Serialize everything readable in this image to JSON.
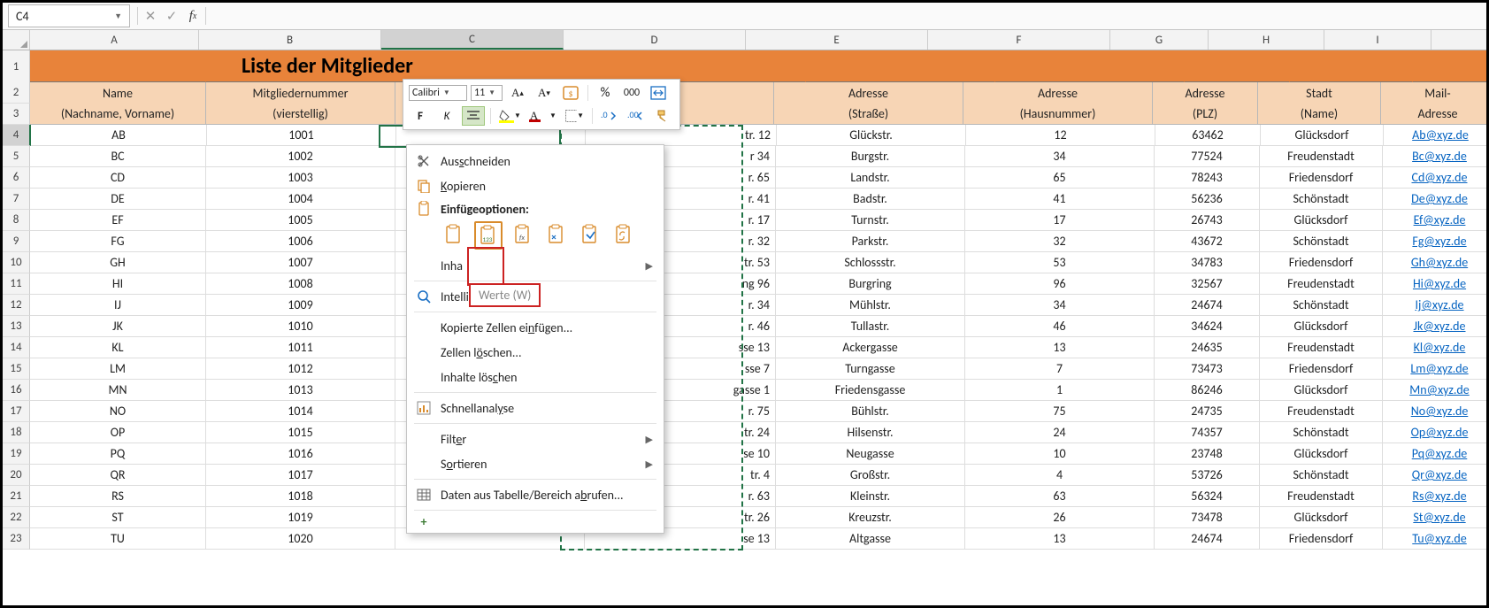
{
  "nameBox": "C4",
  "title": "Liste der Mitglieder",
  "columns": [
    "A",
    "B",
    "C",
    "D",
    "E",
    "F",
    "G",
    "H",
    "I"
  ],
  "headers": {
    "A1": "Name",
    "A2": "(Nachname, Vorname)",
    "B1": "Mitgliedernummer",
    "B2": "(vierstellig)",
    "E1": "Adresse",
    "E2": "(Straße)",
    "F1": "Adresse",
    "F2": "(Hausnummer)",
    "G1": "Adresse",
    "G2": "(PLZ)",
    "H1": "Stadt",
    "H2": "(Name)",
    "I1": "Mail-",
    "I2": "Adresse"
  },
  "rows": [
    {
      "n": "AB",
      "id": "1001",
      "d": "tr. 12",
      "str": "Glückstr.",
      "hn": "12",
      "plz": "63462",
      "city": "Glücksdorf",
      "mail": "Ab@xyz.de"
    },
    {
      "n": "BC",
      "id": "1002",
      "d": "r 34",
      "str": "Burgstr.",
      "hn": "34",
      "plz": "77524",
      "city": "Freudenstadt",
      "mail": "Bc@xyz.de"
    },
    {
      "n": "CD",
      "id": "1003",
      "d": "r. 65",
      "str": "Landstr.",
      "hn": "65",
      "plz": "78243",
      "city": "Friedensdorf",
      "mail": "Cd@xyz.de"
    },
    {
      "n": "DE",
      "id": "1004",
      "d": "r. 41",
      "str": "Badstr.",
      "hn": "41",
      "plz": "56236",
      "city": "Schönstadt",
      "mail": "De@xyz.de"
    },
    {
      "n": "EF",
      "id": "1005",
      "d": "r. 17",
      "str": "Turnstr.",
      "hn": "17",
      "plz": "26743",
      "city": "Glücksdorf",
      "mail": "Ef@xyz.de"
    },
    {
      "n": "FG",
      "id": "1006",
      "d": "r. 32",
      "str": "Parkstr.",
      "hn": "32",
      "plz": "43672",
      "city": "Schönstadt",
      "mail": "Fg@xyz.de"
    },
    {
      "n": "GH",
      "id": "1007",
      "d": "tr. 53",
      "str": "Schlossstr.",
      "hn": "53",
      "plz": "34783",
      "city": "Friedensdorf",
      "mail": "Gh@xyz.de"
    },
    {
      "n": "HI",
      "id": "1008",
      "d": "ng 96",
      "str": "Burgring",
      "hn": "96",
      "plz": "32567",
      "city": "Freudenstadt",
      "mail": "Hi@xyz.de"
    },
    {
      "n": "IJ",
      "id": "1009",
      "d": "r. 34",
      "str": "Mühlstr.",
      "hn": "34",
      "plz": "24674",
      "city": "Schönstadt",
      "mail": "Ij@xyz.de"
    },
    {
      "n": "JK",
      "id": "1010",
      "d": "r. 46",
      "str": "Tullastr.",
      "hn": "46",
      "plz": "34624",
      "city": "Glücksdorf",
      "mail": "Jk@xyz.de"
    },
    {
      "n": "KL",
      "id": "1011",
      "d": "sse 13",
      "str": "Ackergasse",
      "hn": "13",
      "plz": "24635",
      "city": "Freudenstadt",
      "mail": "Kl@xyz.de"
    },
    {
      "n": "LM",
      "id": "1012",
      "d": "sse 7",
      "str": "Turngasse",
      "hn": "7",
      "plz": "73473",
      "city": "Friedensdorf",
      "mail": "Lm@xyz.de"
    },
    {
      "n": "MN",
      "id": "1013",
      "d": "gasse 1",
      "str": "Friedensgasse",
      "hn": "1",
      "plz": "86246",
      "city": "Glücksdorf",
      "mail": "Mn@xyz.de"
    },
    {
      "n": "NO",
      "id": "1014",
      "d": "r. 75",
      "str": "Bühlstr.",
      "hn": "75",
      "plz": "24735",
      "city": "Freudenstadt",
      "mail": "No@xyz.de"
    },
    {
      "n": "OP",
      "id": "1015",
      "d": "tr. 24",
      "str": "Hilsenstr.",
      "hn": "24",
      "plz": "74357",
      "city": "Schönstadt",
      "mail": "Op@xyz.de"
    },
    {
      "n": "PQ",
      "id": "1016",
      "d": "se 10",
      "str": "Neugasse",
      "hn": "10",
      "plz": "23748",
      "city": "Glücksdorf",
      "mail": "Pq@xyz.de"
    },
    {
      "n": "QR",
      "id": "1017",
      "d": "tr. 4",
      "str": "Großstr.",
      "hn": "4",
      "plz": "53726",
      "city": "Schönstadt",
      "mail": "Qr@xyz.de"
    },
    {
      "n": "RS",
      "id": "1018",
      "d": "r. 63",
      "str": "Kleinstr.",
      "hn": "63",
      "plz": "56324",
      "city": "Freudenstadt",
      "mail": "Rs@xyz.de"
    },
    {
      "n": "ST",
      "id": "1019",
      "d": "tr. 26",
      "str": "Kreuzstr.",
      "hn": "26",
      "plz": "73478",
      "city": "Glücksdorf",
      "mail": "St@xyz.de"
    },
    {
      "n": "TU",
      "id": "1020",
      "d": "se 13",
      "str": "Altgasse",
      "hn": "13",
      "plz": "24674",
      "city": "Friedensdorf",
      "mail": "Tu@xyz.de"
    }
  ],
  "miniToolbar": {
    "font": "Calibri",
    "size": "11",
    "bold": "F",
    "italic": "K"
  },
  "contextMenu": {
    "cut": "Ausschneiden",
    "copy": "Kopieren",
    "pasteOptions": "Einfügeoptionen:",
    "pasteSpecialPrefix": "Inha",
    "smartLookup": "Intelligente Suche",
    "insertCopied": "Kopierte Zellen einfügen...",
    "deleteCells": "Zellen löschen...",
    "clearContents": "Inhalte löschen",
    "quickAnalysis": "Schnellanalyse",
    "filter": "Filter",
    "sort": "Sortieren",
    "fromTable": "Daten aus Tabelle/Bereich abrufen...",
    "tooltip": "Werte (W)"
  }
}
